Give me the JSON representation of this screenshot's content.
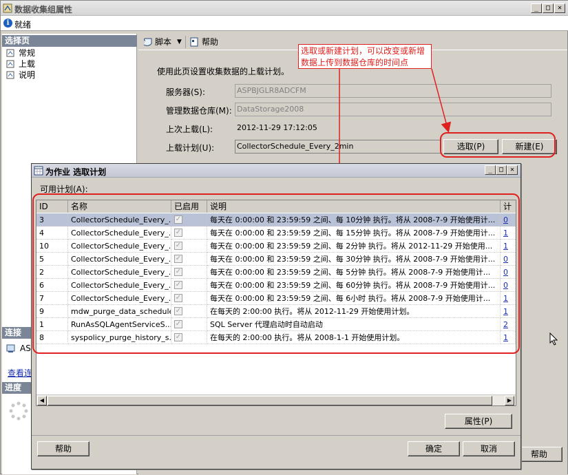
{
  "window": {
    "title": "数据收集组属性",
    "status": "就绪"
  },
  "left": {
    "select_page_header": "选择页",
    "pages": [
      {
        "label": "常规"
      },
      {
        "label": "上载"
      },
      {
        "label": "说明"
      }
    ],
    "connection_header": "连接",
    "connection_text": "AS",
    "view_link": "查看连",
    "progress_header": "进度"
  },
  "toolbar": {
    "script_label": "脚本",
    "help_label": "帮助"
  },
  "upload": {
    "description": "使用此页设置收集数据的上载计划。",
    "server_label": "服务器(S):",
    "server_value": "ASPBJGLR8ADCFM",
    "warehouse_label": "管理数据仓库(M):",
    "warehouse_value": "DataStorage2008",
    "last_upload_label": "上次上载(L):",
    "last_upload_value": "2012-11-29 17:12:05",
    "schedule_label": "上载计划(U):",
    "schedule_value": "CollectorSchedule_Every_2min",
    "pick_button": "选取(P)",
    "new_button": "新建(E)",
    "outer_help_button": "帮助"
  },
  "annotation": {
    "callout_text": "选取或新建计划，可以改变或新增数据上传到数据仓库的时间点",
    "color": "#e0201e"
  },
  "dialog": {
    "title": "为作业 选取计划",
    "available_label": "可用计划(A):",
    "columns": [
      "ID",
      "名称",
      "已启用",
      "说明",
      "计划"
    ],
    "rows": [
      {
        "id": "3",
        "name": "CollectorSchedule_Every_...",
        "enabled": "✓",
        "desc": "每天在 0:00:00 和 23:59:59 之间、每 10分钟 执行。将从 2008-7-9 开始使用计...",
        "count": "0"
      },
      {
        "id": "4",
        "name": "CollectorSchedule_Every_...",
        "enabled": "✓",
        "desc": "每天在 0:00:00 和 23:59:59 之间、每 15分钟 执行。将从 2008-7-9 开始使用计...",
        "count": "1"
      },
      {
        "id": "10",
        "name": "CollectorSchedule_Every_...",
        "enabled": "✓",
        "desc": "每天在 0:00:00 和 23:59:59 之间、每 2分钟 执行。将从 2012-11-29 开始使用...",
        "count": "1"
      },
      {
        "id": "5",
        "name": "CollectorSchedule_Every_...",
        "enabled": "✓",
        "desc": "每天在 0:00:00 和 23:59:59 之间、每 30分钟 执行。将从 2008-7-9 开始使用计...",
        "count": "0"
      },
      {
        "id": "2",
        "name": "CollectorSchedule_Every_...",
        "enabled": "✓",
        "desc": "每天在 0:00:00 和 23:59:59 之间、每 5分钟 执行。将从 2008-7-9 开始使用计...",
        "count": "0"
      },
      {
        "id": "6",
        "name": "CollectorSchedule_Every_...",
        "enabled": "✓",
        "desc": "每天在 0:00:00 和 23:59:59 之间、每 60分钟 执行。将从 2008-7-9 开始使用计...",
        "count": "0"
      },
      {
        "id": "7",
        "name": "CollectorSchedule_Every_...",
        "enabled": "✓",
        "desc": "每天在 0:00:00 和 23:59:59 之间、每 6小时 执行。将从 2008-7-9 开始使用计...",
        "count": "1"
      },
      {
        "id": "9",
        "name": "mdw_purge_data_schedule",
        "enabled": "✓",
        "desc": "在每天的 2:00:00 执行。将从 2012-11-29 开始使用计划。",
        "count": "1"
      },
      {
        "id": "1",
        "name": "RunAsSQLAgentServiceS...",
        "enabled": "✓",
        "desc": "SQL Server 代理启动时自动启动",
        "count": "2"
      },
      {
        "id": "8",
        "name": "syspolicy_purge_history_s...",
        "enabled": "✓",
        "desc": "在每天的 2:00:00 执行。将从 2008-1-1 开始使用计划。",
        "count": "1"
      }
    ],
    "properties_button": "属性(P)",
    "help_button": "帮助",
    "ok_button": "确定",
    "cancel_button": "取消"
  }
}
